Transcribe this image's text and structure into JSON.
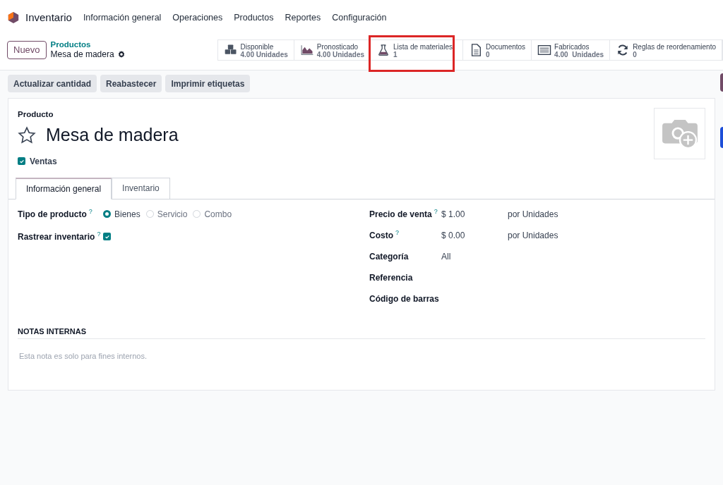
{
  "navbar": {
    "app": "Inventario",
    "menu": [
      "Información general",
      "Operaciones",
      "Productos",
      "Reportes",
      "Configuración"
    ]
  },
  "control_panel": {
    "new_button": "Nuevo",
    "breadcrumb": "Productos",
    "record": "Mesa de madera"
  },
  "smart_buttons": [
    {
      "kind": "boxes",
      "label": "Disponible",
      "value": "4.00 Unidades",
      "highlighted": false
    },
    {
      "kind": "area",
      "label": "Pronosticado",
      "value": "4.00 Unidades",
      "highlighted": false
    },
    {
      "kind": "flask",
      "label": "Lista de materiales",
      "value": "1",
      "highlighted": true
    },
    {
      "kind": "file",
      "label": "Documentos",
      "value": "0",
      "highlighted": false
    },
    {
      "kind": "list",
      "label": "Fabricados",
      "value": "4.00  Unidades",
      "highlighted": false
    },
    {
      "kind": "refresh",
      "label": "Reglas de reordenamiento",
      "value": "0",
      "highlighted": false
    }
  ],
  "actions": [
    "Actualizar cantidad",
    "Reabastecer",
    "Imprimir etiquetas"
  ],
  "form": {
    "caption": "Producto",
    "name": "Mesa de madera",
    "favorite": false,
    "sales": {
      "label": "Ventas",
      "checked": true
    },
    "tabs": [
      {
        "label": "Información general",
        "selected": true
      },
      {
        "label": "Inventario",
        "selected": false
      }
    ],
    "product_type": {
      "label": "Tipo de producto",
      "help": "?",
      "options": [
        {
          "label": "Bienes",
          "selected": true
        },
        {
          "label": "Servicio",
          "selected": false
        },
        {
          "label": "Combo",
          "selected": false
        }
      ]
    },
    "track_inventory": {
      "label": "Rastrear inventario",
      "help": "?",
      "checked": true
    },
    "right_fields": [
      {
        "label": "Precio de venta",
        "help": "?",
        "value": "$ 1.00",
        "unit": "por Unidades"
      },
      {
        "label": "Costo",
        "help": "?",
        "value": "$ 0.00",
        "unit": "por Unidades"
      },
      {
        "label": "Categoría",
        "value": "All"
      },
      {
        "label": "Referencia"
      },
      {
        "label": "Código de barras"
      }
    ],
    "notes": {
      "title": "NOTAS INTERNAS",
      "placeholder": "Esta nota es solo para fines internos."
    }
  }
}
